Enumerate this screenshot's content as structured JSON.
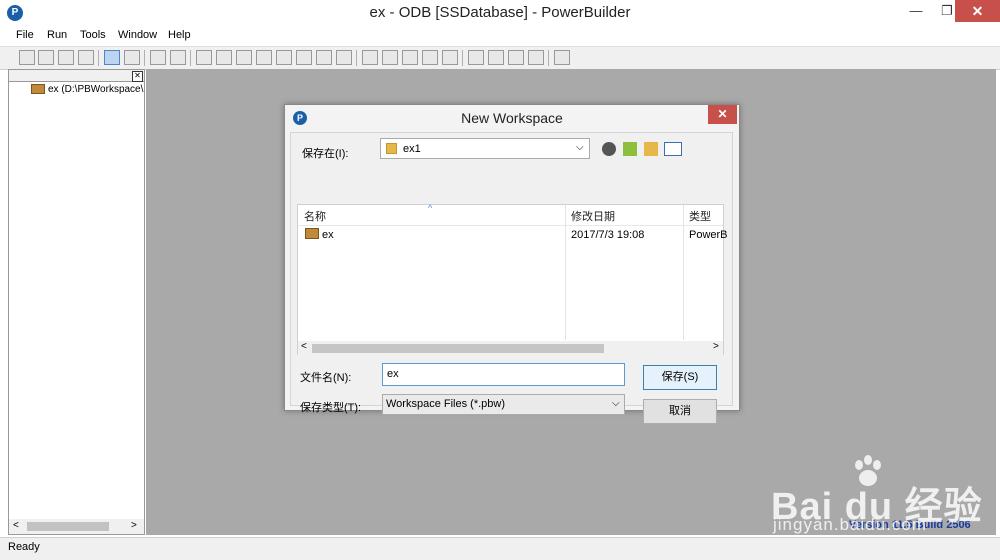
{
  "window": {
    "title": "ex - ODB [SSDatabase]  - PowerBuilder",
    "app_icon_letter": "P",
    "min_label": "—",
    "max_label": "❐",
    "close_label": "✕"
  },
  "menu": {
    "items": [
      "File",
      "Run",
      "Tools",
      "Window",
      "Help"
    ]
  },
  "tree": {
    "item_label": "ex (D:\\PBWorkspace\\",
    "panel_close": "✕",
    "scroll_left": "<",
    "scroll_right": ">"
  },
  "status": {
    "text": "Ready",
    "version": "Version 11.5 Build 2506"
  },
  "dialog": {
    "title": "New Workspace",
    "icon_letter": "P",
    "close_label": "✕",
    "save_in_label": "保存在(I):",
    "save_in_value": "ex1",
    "columns": [
      "名称",
      "修改日期",
      "类型"
    ],
    "files": [
      {
        "name": "ex",
        "modified": "2017/7/3 19:08",
        "type": "PowerB"
      }
    ],
    "filename_label": "文件名(N):",
    "filename_value": "ex",
    "filetype_label": "保存类型(T):",
    "filetype_value": "Workspace Files (*.pbw)",
    "save_button": "保存(S)",
    "cancel_button": "取消",
    "scroll_left": "<",
    "scroll_right": ">"
  },
  "watermark": {
    "brand": "Bai du 经验",
    "sub": "jingyan.baidu.com"
  },
  "colors": {
    "accent": "#1b5fa8",
    "close_red": "#c7504a",
    "workspace_gray": "#a9a9a9"
  }
}
